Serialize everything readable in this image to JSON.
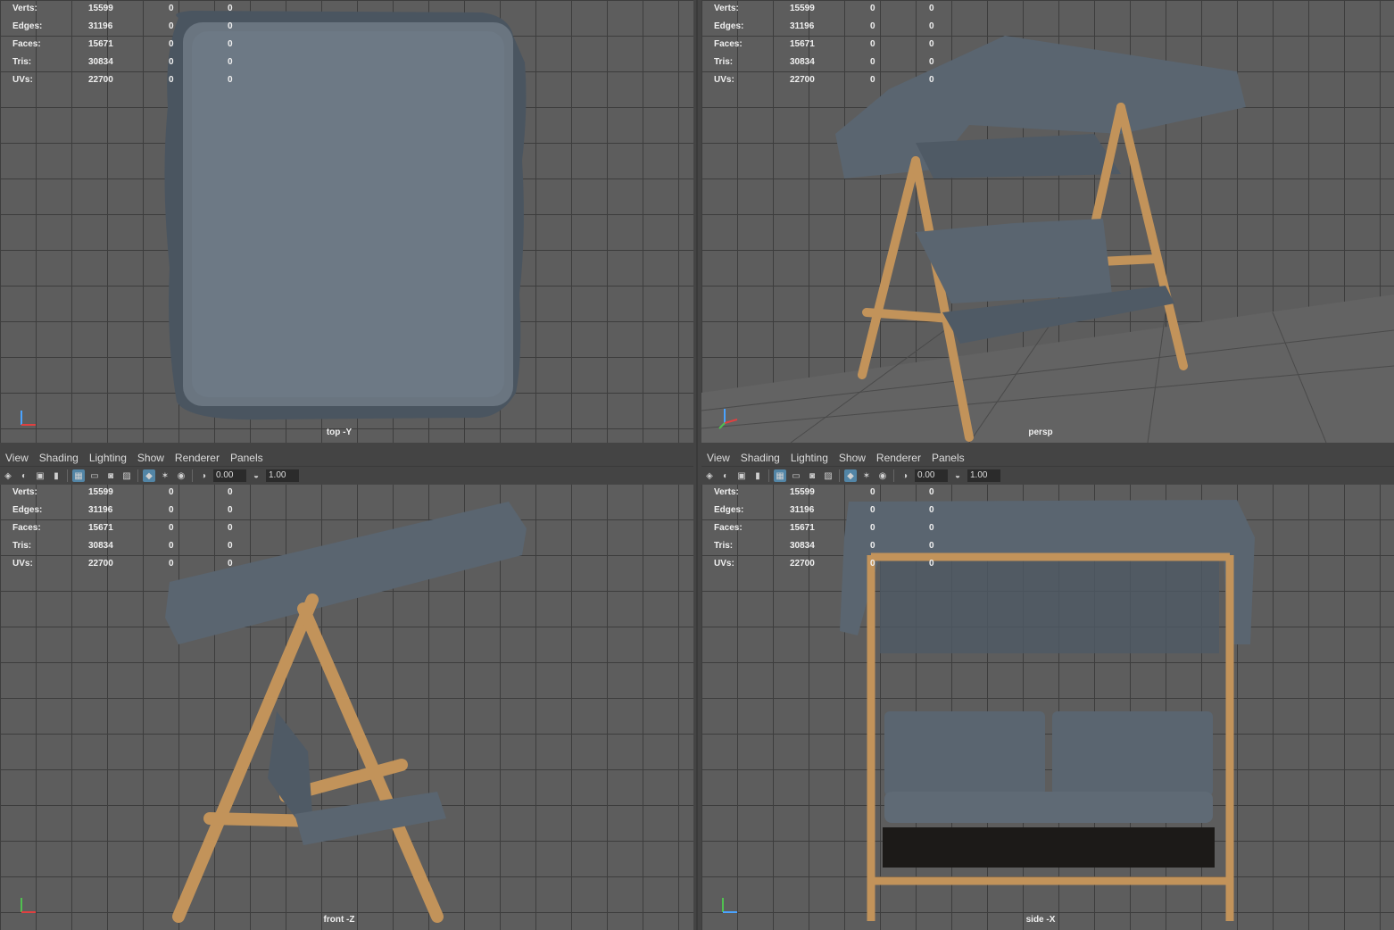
{
  "panel_menu": [
    "View",
    "Shading",
    "Lighting",
    "Show",
    "Renderer",
    "Panels"
  ],
  "toolbar": {
    "field_a": "0.00",
    "field_b": "1.00"
  },
  "heads_up": {
    "labels": [
      "Verts:",
      "Edges:",
      "Faces:",
      "Tris:",
      "UVs:"
    ],
    "values": [
      "15599",
      "31196",
      "15671",
      "30834",
      "22700"
    ],
    "zeros": [
      "0",
      "0"
    ]
  },
  "viewports": {
    "top": {
      "camera": "top -Y"
    },
    "persp": {
      "camera": "persp"
    },
    "front": {
      "camera": "front -Z"
    },
    "side": {
      "camera": "side -X"
    }
  },
  "colors": {
    "viewport_bg": "#5d5d5d",
    "grid_line": "#3d3d3d",
    "cushion": "#5a6570",
    "wood": "#c2935a",
    "ui_bg": "#444444",
    "active_icon": "#5285a6"
  },
  "icons": [
    "select-icon",
    "lasso-icon",
    "camera-icon",
    "bookmark-icon",
    "grid-icon",
    "wireframe-icon",
    "shaded-icon",
    "textured-icon",
    "light-icon",
    "isolate-icon",
    "exposure-icon",
    "gamma-icon"
  ]
}
